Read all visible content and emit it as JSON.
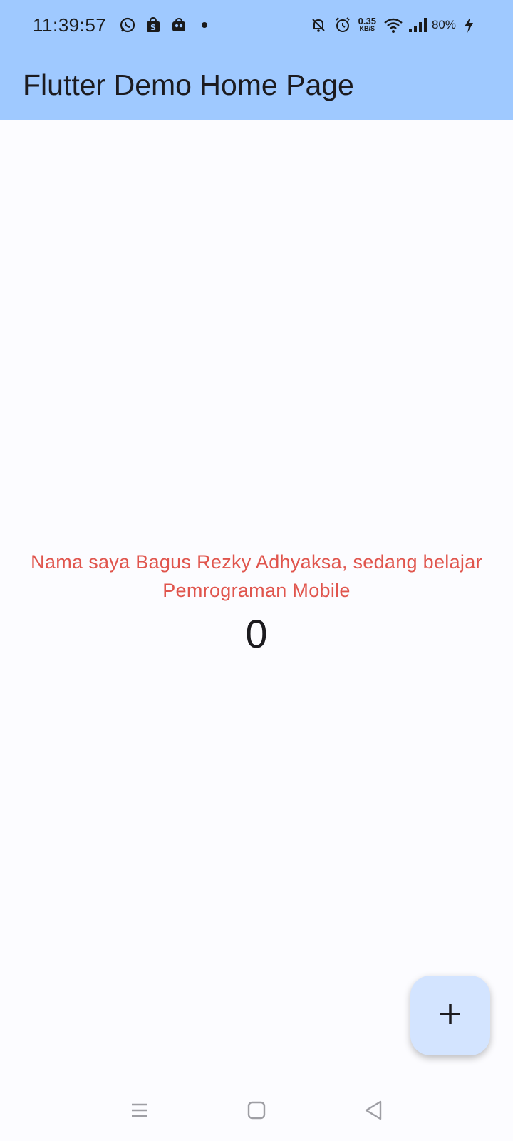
{
  "status_bar": {
    "time": "11:39:57",
    "net_speed_value": "0.35",
    "net_speed_unit": "KB/S",
    "battery": "80%",
    "left_icons": [
      "whatsapp-icon",
      "shopee-icon",
      "bag-icon",
      "dot-icon"
    ],
    "right_icons": [
      "bell-off-icon",
      "alarm-icon",
      "wifi-icon",
      "signal-icon",
      "charging-icon"
    ]
  },
  "app_bar": {
    "title": "Flutter Demo Home Page",
    "color": "#9fc9ff"
  },
  "main": {
    "message": "Nama saya Bagus Rezky Adhyaksa, sedang belajar Pemrograman Mobile",
    "counter": "0",
    "message_color": "#e0554d"
  },
  "fab": {
    "icon": "plus-icon",
    "color": "#d3e4ff"
  },
  "nav_bar": {
    "icons": [
      "menu-icon",
      "home-square-icon",
      "back-triangle-icon"
    ]
  }
}
